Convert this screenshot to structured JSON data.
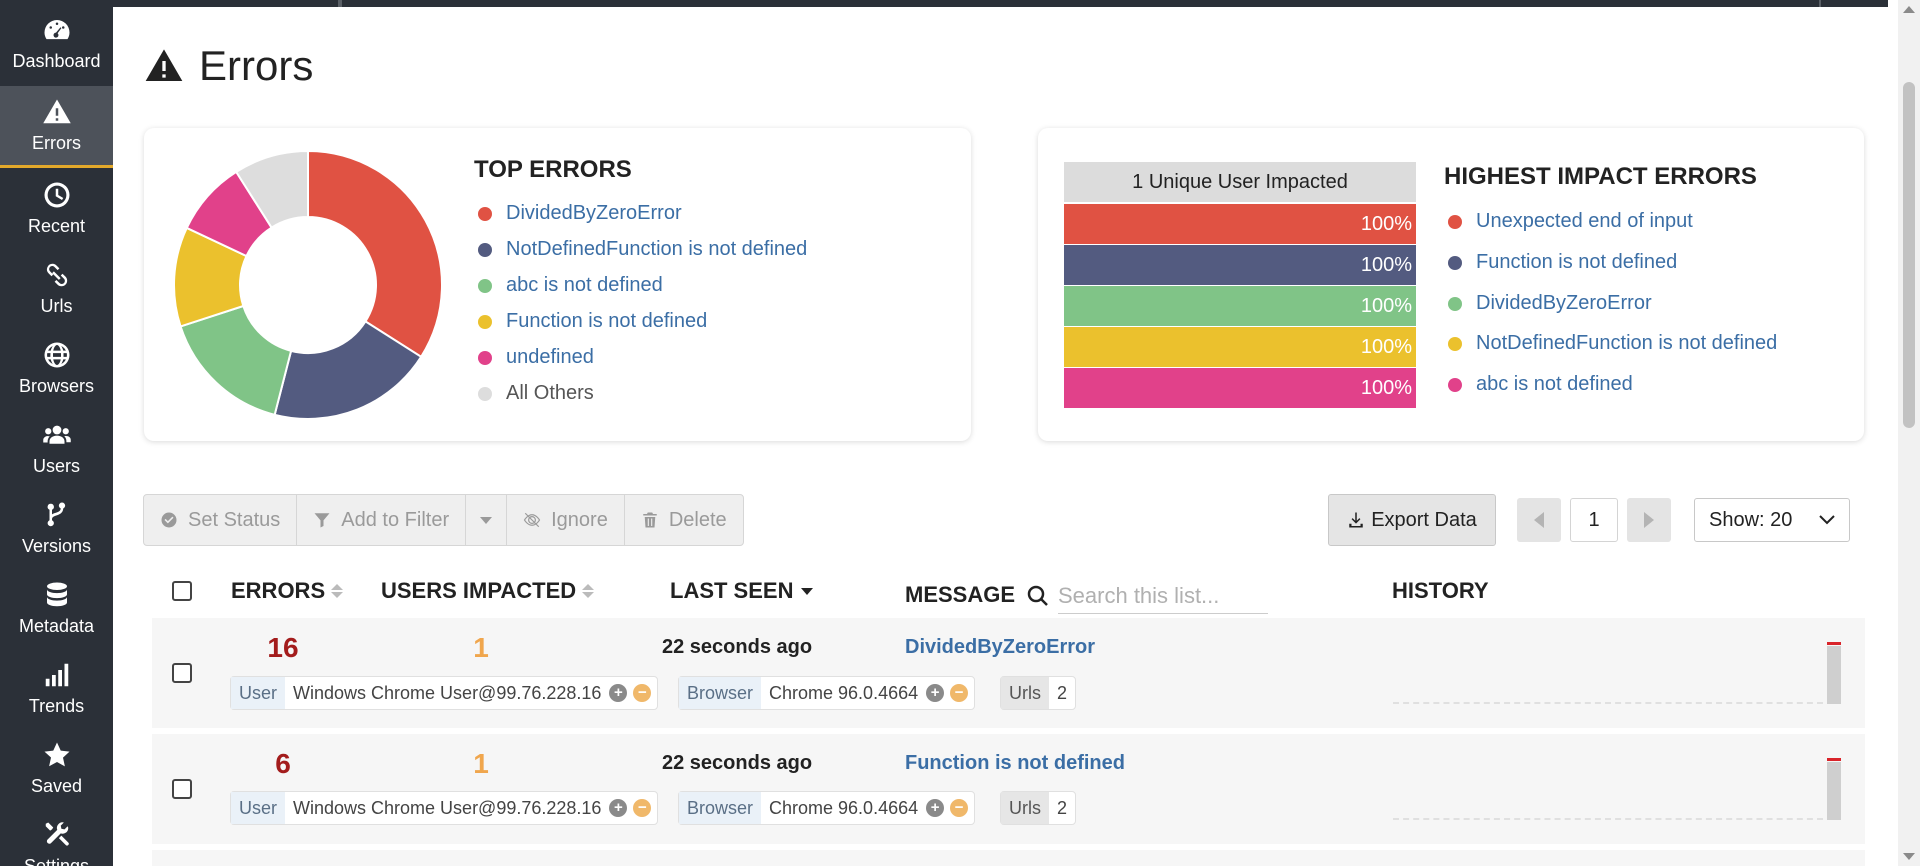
{
  "sidebar": {
    "items": [
      {
        "label": "Dashboard",
        "icon": "dashboard-icon"
      },
      {
        "label": "Errors",
        "icon": "warning-icon",
        "active": true
      },
      {
        "label": "Recent",
        "icon": "clock-icon"
      },
      {
        "label": "Urls",
        "icon": "link-icon"
      },
      {
        "label": "Browsers",
        "icon": "globe-icon"
      },
      {
        "label": "Users",
        "icon": "users-icon"
      },
      {
        "label": "Versions",
        "icon": "branch-icon"
      },
      {
        "label": "Metadata",
        "icon": "database-icon"
      },
      {
        "label": "Trends",
        "icon": "bar-chart-icon"
      },
      {
        "label": "Saved",
        "icon": "star-icon"
      },
      {
        "label": "Settings",
        "icon": "tools-icon"
      }
    ]
  },
  "page": {
    "title": "Errors"
  },
  "top_errors": {
    "title": "TOP ERRORS",
    "legend": [
      {
        "label": "DividedByZeroError",
        "color": "#e05243"
      },
      {
        "label": "NotDefinedFunction is not defined",
        "color": "#535b80"
      },
      {
        "label": "abc is not defined",
        "color": "#80c487"
      },
      {
        "label": "Function is not defined",
        "color": "#ebc12d"
      },
      {
        "label": "undefined",
        "color": "#e1418a"
      },
      {
        "label": "All Others",
        "color": "#dddddd"
      }
    ]
  },
  "chart_data": {
    "type": "pie",
    "title": "TOP ERRORS",
    "categories": [
      "DividedByZeroError",
      "NotDefinedFunction is not defined",
      "abc is not defined",
      "Function is not defined",
      "undefined",
      "All Others"
    ],
    "values": [
      34,
      20,
      16,
      12,
      9,
      9
    ],
    "colors": [
      "#e05243",
      "#535b80",
      "#80c487",
      "#ebc12d",
      "#e1418a",
      "#dddddd"
    ]
  },
  "highest_impact": {
    "title": "HIGHEST IMPACT ERRORS",
    "header": "1 Unique User Impacted",
    "bars": [
      {
        "value": "100%",
        "color": "#e05243"
      },
      {
        "value": "100%",
        "color": "#535b80"
      },
      {
        "value": "100%",
        "color": "#80c487"
      },
      {
        "value": "100%",
        "color": "#ebc12d"
      },
      {
        "value": "100%",
        "color": "#e1418a"
      }
    ],
    "legend": [
      {
        "label": "Unexpected end of input",
        "color": "#e05243"
      },
      {
        "label": "Function is not defined",
        "color": "#535b80"
      },
      {
        "label": "DividedByZeroError",
        "color": "#80c487"
      },
      {
        "label": "NotDefinedFunction is not defined",
        "color": "#ebc12d"
      },
      {
        "label": "abc is not defined",
        "color": "#e1418a"
      }
    ]
  },
  "toolbar": {
    "set_status": "Set Status",
    "add_to_filter": "Add to Filter",
    "ignore": "Ignore",
    "delete": "Delete",
    "export": "Export Data",
    "page": "1",
    "show": "Show: 20"
  },
  "table": {
    "headers": {
      "errors": "ERRORS",
      "users_impacted": "USERS IMPACTED",
      "last_seen": "LAST SEEN",
      "message": "MESSAGE",
      "history": "HISTORY"
    },
    "search_placeholder": "Search this list...",
    "rows": [
      {
        "errors": "16",
        "users": "1",
        "last_seen": "22 seconds ago",
        "message": "DividedByZeroError",
        "user_key": "User",
        "user_value": "Windows Chrome User@99.76.228.16",
        "browser_key": "Browser",
        "browser_value": "Chrome 96.0.4664",
        "urls_key": "Urls",
        "urls_value": "2",
        "plus": "+",
        "minus": "−"
      },
      {
        "errors": "6",
        "users": "1",
        "last_seen": "22 seconds ago",
        "message": "Function is not defined",
        "user_key": "User",
        "user_value": "Windows Chrome User@99.76.228.16",
        "browser_key": "Browser",
        "browser_value": "Chrome 96.0.4664",
        "urls_key": "Urls",
        "urls_value": "2",
        "plus": "+",
        "minus": "−"
      }
    ]
  }
}
